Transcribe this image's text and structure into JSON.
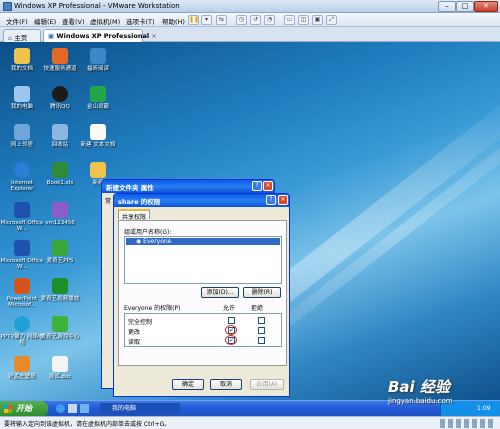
{
  "app": {
    "title": "Windows XP Professional - VMware Workstation"
  },
  "colors": {
    "accent": "#245edb",
    "xp_title": "#0a58e6",
    "highlight": "#316ac5",
    "annotation": "#d6261e"
  },
  "menu": [
    {
      "label": "文件(F)"
    },
    {
      "label": "编辑(E)"
    },
    {
      "label": "查看(V)"
    },
    {
      "label": "虚拟机(M)"
    },
    {
      "label": "选项卡(T)"
    },
    {
      "label": "帮助(H)"
    }
  ],
  "tabs": {
    "home": "主页",
    "vm": "Windows XP Professional"
  },
  "desktop": {
    "icons": [
      {
        "label": "我的文档"
      },
      {
        "label": "快速服务通道"
      },
      {
        "label": "福昕阅读"
      },
      {
        "label": "我的电脑"
      },
      {
        "label": "腾讯QQ"
      },
      {
        "label": "金山词霸"
      },
      {
        "label": "网上邻居"
      },
      {
        "label": "回收站"
      },
      {
        "label": "新建 文本文档"
      },
      {
        "label": "Internet Explorer"
      },
      {
        "label": "Book1.xls"
      },
      {
        "label": "新建"
      },
      {
        "label": "Microsoft Office W..."
      },
      {
        "label": "vm123456"
      },
      {
        "label": "Microsoft Office W..."
      },
      {
        "label": "爱奇艺PPS"
      },
      {
        "label": "PowerPoint Microsof..."
      },
      {
        "label": "爱奇艺视频播放"
      },
      {
        "label": "PPTV聚力 网络电视"
      },
      {
        "label": "爱奇艺游戏中心"
      },
      {
        "label": "好孟庄壁纸"
      },
      {
        "label": "测试.doc"
      }
    ]
  },
  "props_dialog": {
    "title": "新建文件夹 属性",
    "tab_hint": "常"
  },
  "share_dialog": {
    "title": "share 的权限",
    "tab": "共享权限",
    "group_label": "组或用户名称(G):",
    "users": [
      {
        "name": "Everyone"
      }
    ],
    "add_btn": "添加(D)...",
    "remove_btn": "删除(R)",
    "perm_label": "Everyone 的权限(P)",
    "col_allow": "允许",
    "col_deny": "拒绝",
    "permissions": [
      {
        "name": "完全控制",
        "allow": false,
        "deny": false
      },
      {
        "name": "更改",
        "allow": true,
        "deny": false
      },
      {
        "name": "读取",
        "allow": true,
        "deny": false
      }
    ],
    "ok": "确定",
    "cancel": "取消",
    "apply": "应用(A)"
  },
  "taskbar": {
    "start": "开始",
    "task": "我的电脑",
    "clock": "1:09"
  },
  "status": {
    "text": "要将输入定向到该虚拟机，请在虚拟机内部单击或按 Ctrl+G。"
  },
  "watermark": {
    "brand": "Bai 经验",
    "url": "jingyan.baidu.com"
  }
}
